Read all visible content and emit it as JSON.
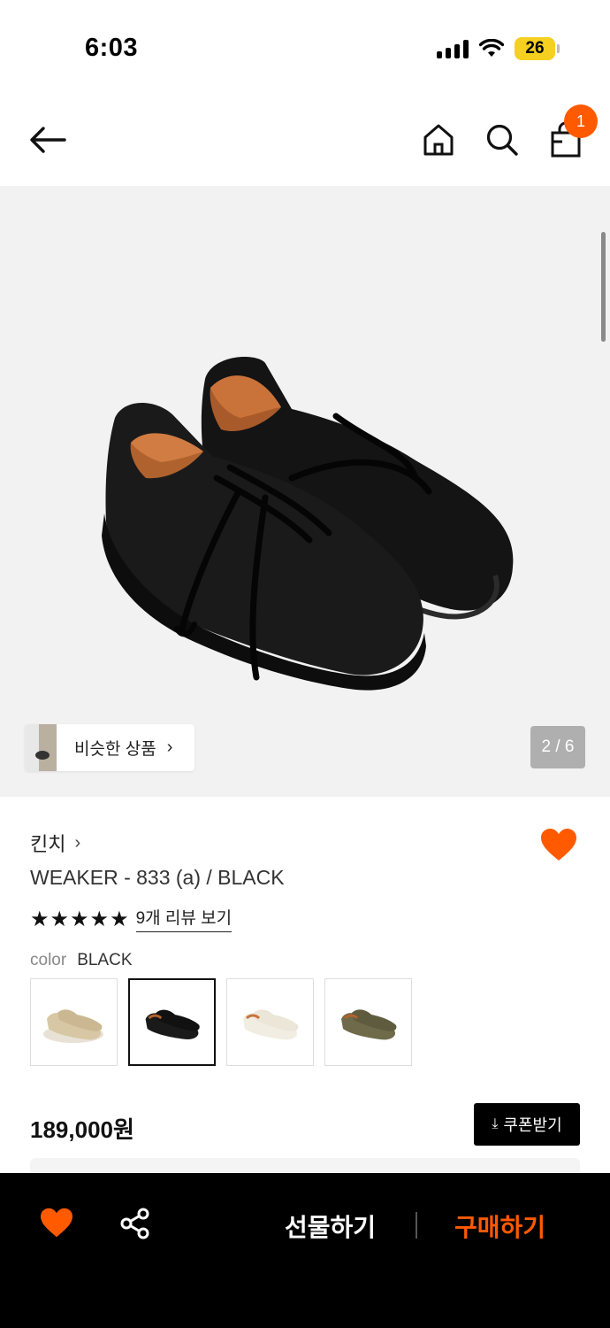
{
  "status_bar": {
    "time": "6:03",
    "battery": "26",
    "icons": [
      "signal-icon",
      "wifi-icon",
      "battery-icon"
    ]
  },
  "header": {
    "icons": [
      "back-arrow-icon",
      "home-icon",
      "search-icon",
      "shopping-bag-icon"
    ],
    "cart_count": "1"
  },
  "hero": {
    "similar_label": "비슷한 상품",
    "page_counter": "2 / 6"
  },
  "product": {
    "brand": "킨치",
    "name": "WEAKER - 833 (a) / BLACK",
    "rating": 5,
    "review_link": "9개 리뷰 보기",
    "option_label": "color",
    "option_value": "BLACK",
    "swatches": [
      {
        "color": "beige",
        "selected": false
      },
      {
        "color": "black",
        "selected": true
      },
      {
        "color": "ivory",
        "selected": false
      },
      {
        "color": "khaki",
        "selected": false
      }
    ],
    "price": "189,000원",
    "coupon_label": "쿠폰받기"
  },
  "bottom_bar": {
    "gift_label": "선물하기",
    "buy_label": "구매하기",
    "icons": [
      "heart-icon",
      "share-icon"
    ]
  },
  "colors": {
    "accent": "#ff5a00",
    "bottom_bar_bg": "#000000",
    "hero_bg": "#f2f2f2"
  }
}
